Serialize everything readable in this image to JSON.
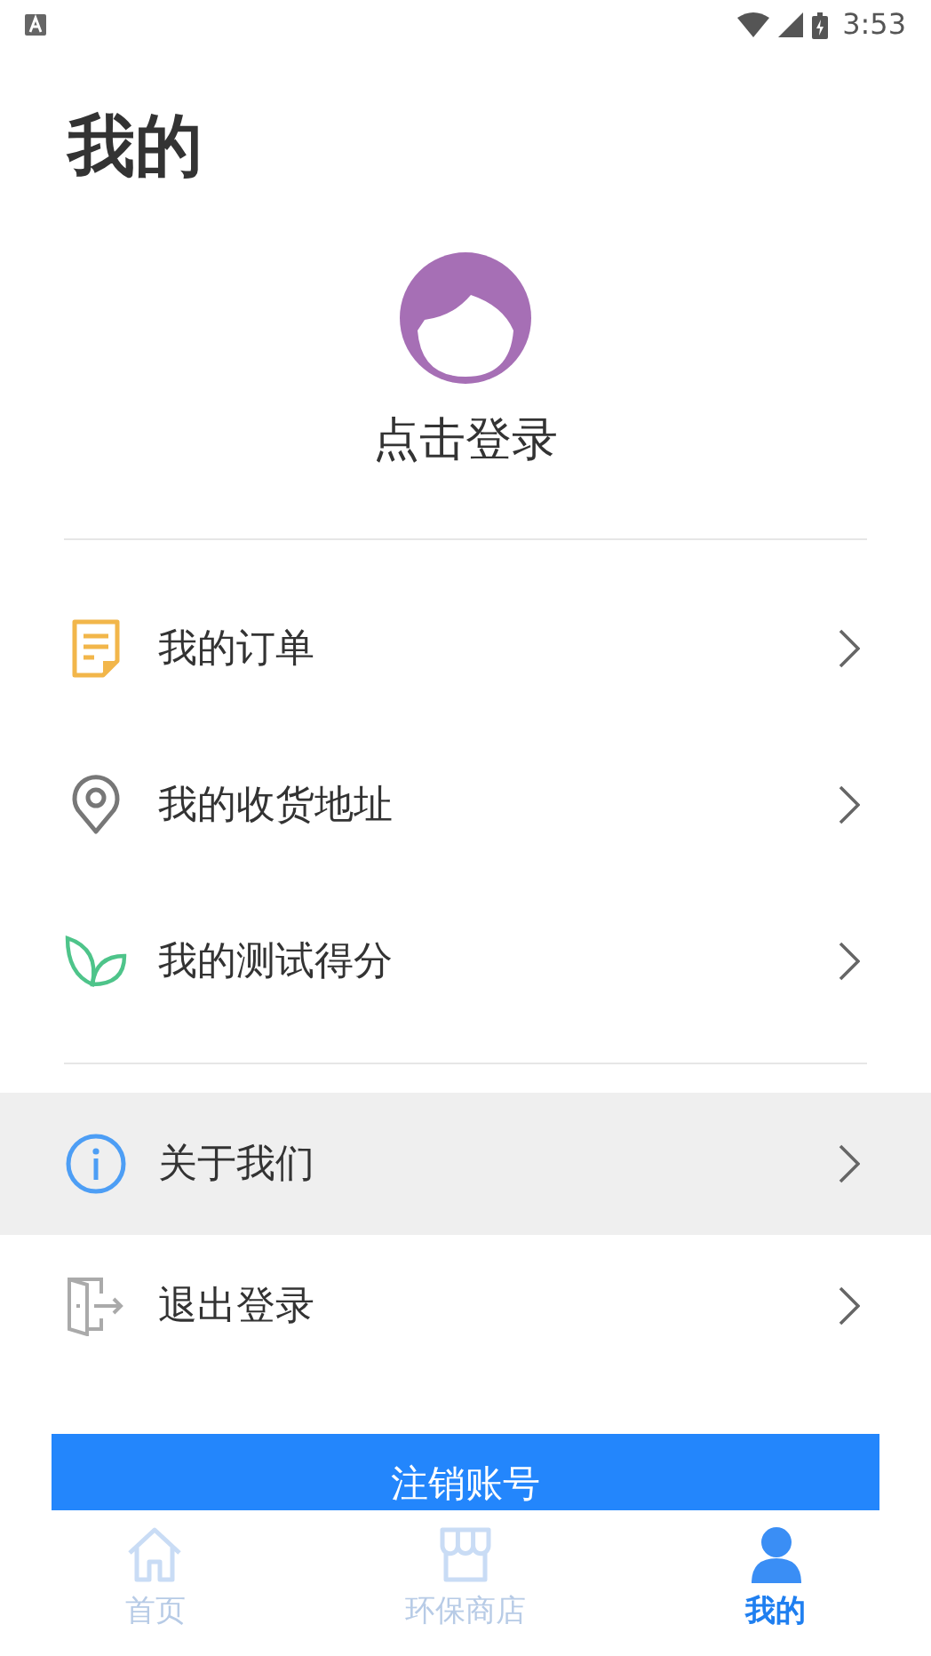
{
  "status_bar": {
    "time": "3:53"
  },
  "title": "我的",
  "profile": {
    "login_label": "点击登录"
  },
  "menu_groups": [
    [
      {
        "kind": "order",
        "label": "我的订单",
        "selected": false
      },
      {
        "kind": "address",
        "label": "我的收货地址",
        "selected": false
      },
      {
        "kind": "score",
        "label": "我的测试得分",
        "selected": false
      }
    ],
    [
      {
        "kind": "about",
        "label": "关于我们",
        "selected": true
      },
      {
        "kind": "logout",
        "label": "退出登录",
        "selected": false
      }
    ]
  ],
  "cancel_button": "注销账号",
  "tabs": [
    {
      "kind": "home",
      "label": "首页",
      "selected": false
    },
    {
      "kind": "shop",
      "label": "环保商店",
      "selected": false
    },
    {
      "kind": "me",
      "label": "我的",
      "selected": true
    }
  ]
}
